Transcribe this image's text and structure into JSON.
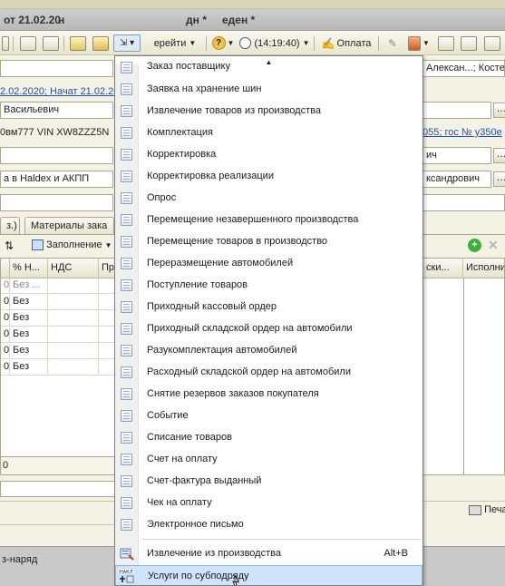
{
  "title": {
    "left": "от 21.02.20",
    "left_suffix": "н",
    "mid1": "дн *",
    "mid2": "еден *"
  },
  "toolbar": {
    "goto_label": "ерейти",
    "time_label": "(14:19:40)",
    "pay_label": "Оплата"
  },
  "form": {
    "customer_field": "Алексан...; Костен",
    "date_link": "2.02.2020; Начат 21.02.20",
    "name_field": "Васильевич",
    "vehicle_field": "0вм777 VIN XW8ZZZ5N",
    "vehicle_link": "055; гос № у350е",
    "field_ich": "ич",
    "reason_field": "а в Haldex и АКПП",
    "person_field": "ксандрович"
  },
  "tabs": [
    {
      "label": "з.)"
    },
    {
      "label": "Материалы зака"
    }
  ],
  "grid_toolbar": {
    "fill_label": "Заполнение"
  },
  "grid": {
    "headers": [
      "% Н...",
      "НДС",
      "Пр"
    ],
    "right_headers": [
      "ски...",
      "Исполни"
    ],
    "rows": [
      {
        "num": "0",
        "vat": "Без ..."
      },
      {
        "num": "0",
        "vat": "Без"
      },
      {
        "num": "0",
        "vat": "Без"
      },
      {
        "num": "0",
        "vat": "Без"
      },
      {
        "num": "0",
        "vat": "Без"
      },
      {
        "num": "0",
        "vat": "Без"
      }
    ],
    "footer_value": "0"
  },
  "print_label": "Печа",
  "status": {
    "left_text": "з-наряд"
  },
  "menu": {
    "items": [
      {
        "label": "Заказ поставщику",
        "shortcut": ""
      },
      {
        "label": "Заявка на хранение шин",
        "shortcut": ""
      },
      {
        "label": "Извлечение товаров из производства",
        "shortcut": ""
      },
      {
        "label": "Комплектация",
        "shortcut": ""
      },
      {
        "label": "Корректировка",
        "shortcut": ""
      },
      {
        "label": "Корректировка реализации",
        "shortcut": ""
      },
      {
        "label": "Опрос",
        "shortcut": ""
      },
      {
        "label": "Перемещение незавершенного производства",
        "shortcut": ""
      },
      {
        "label": "Перемещение товаров в производство",
        "shortcut": ""
      },
      {
        "label": "Переразмещение автомобилей",
        "shortcut": ""
      },
      {
        "label": "Поступление товаров",
        "shortcut": ""
      },
      {
        "label": "Приходный кассовый ордер",
        "shortcut": ""
      },
      {
        "label": "Приходный складской ордер на автомобили",
        "shortcut": ""
      },
      {
        "label": "Разукомплектация автомобилей",
        "shortcut": ""
      },
      {
        "label": "Расходный складской ордер на автомобили",
        "shortcut": ""
      },
      {
        "label": "Снятие резервов заказов покупателя",
        "shortcut": ""
      },
      {
        "label": "Событие",
        "shortcut": ""
      },
      {
        "label": "Списание товаров",
        "shortcut": ""
      },
      {
        "label": "Счет на оплату",
        "shortcut": ""
      },
      {
        "label": "Счет-фактура выданный",
        "shortcut": ""
      },
      {
        "label": "Чек на оплату",
        "shortcut": ""
      },
      {
        "label": "Электронное письмо",
        "shortcut": ""
      }
    ],
    "extra_items": [
      {
        "label": "Извлечение из производства",
        "shortcut": "Alt+B"
      },
      {
        "label": "Услуги по субподряду",
        "shortcut": ""
      }
    ],
    "highlight_color": "#cfe3fb"
  }
}
